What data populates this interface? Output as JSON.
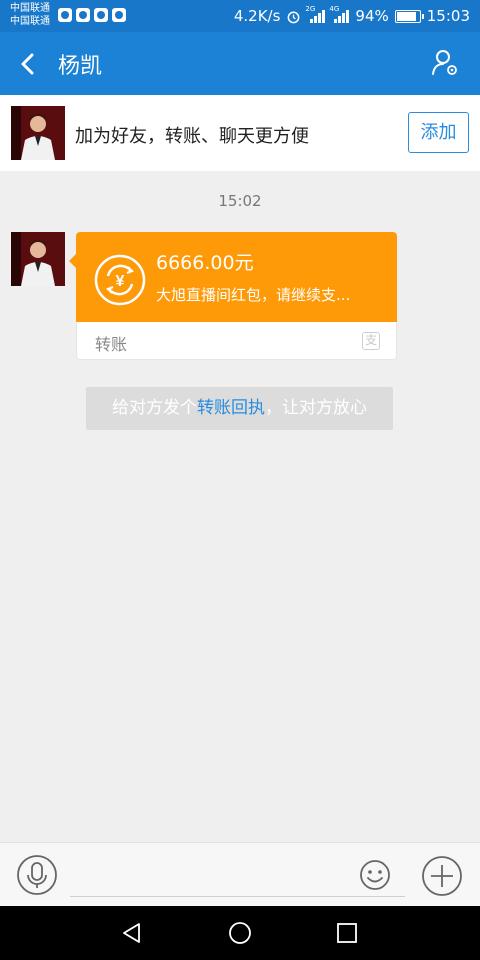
{
  "status_bar": {
    "carrier_1": "中国联通",
    "carrier_2": "中国联通",
    "speed": "4.2K/s",
    "net_1": "2G",
    "net_2": "4G",
    "battery": "94%",
    "battery_level": 0.94,
    "time": "15:03"
  },
  "header": {
    "title": "杨凯",
    "back_icon": "chevron-left-icon",
    "profile_icon": "person-settings-icon"
  },
  "banner": {
    "text": "加为好友，转账、聊天更方便",
    "add_label": "添加"
  },
  "chat": {
    "timestamp": "15:02",
    "transfer": {
      "amount": "6666.00元",
      "description": "大旭直播间红包，请继续支...",
      "type_label": "转账",
      "alipay_glyph": "支"
    },
    "notice": {
      "prefix": "给对方发个",
      "link": "转账回执",
      "suffix": "，让对方放心"
    }
  },
  "colors": {
    "header": "#1c82d6",
    "status_bar": "#1877c8",
    "transfer_card": "#fe9a08",
    "accent": "#2a8cde"
  }
}
